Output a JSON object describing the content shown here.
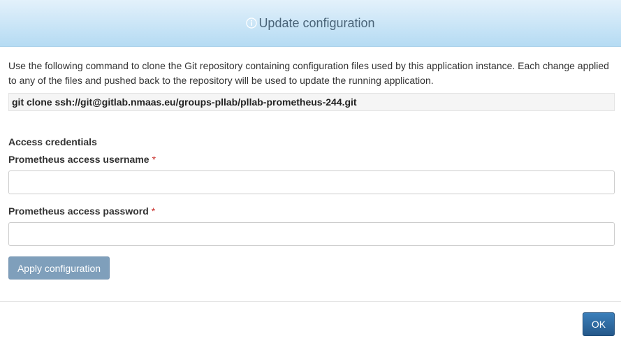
{
  "header": {
    "title": "Update configuration",
    "icon": "info-icon"
  },
  "intro": {
    "text": "Use the following command to clone the Git repository containing configuration files used by this application instance. Each change applied to any of the files and pushed back to the repository will be used to update the running application."
  },
  "command": {
    "text": "git clone ssh://git@gitlab.nmaas.eu/groups-pllab/pllab-prometheus-244.git"
  },
  "credentials": {
    "section_title": "Access credentials",
    "username_label": "Prometheus access username",
    "username_value": "",
    "password_label": "Prometheus access password",
    "password_value": "",
    "required_marker": "*"
  },
  "actions": {
    "apply_label": "Apply configuration",
    "ok_label": "OK"
  },
  "colors": {
    "header_gradient_top": "#e3f1fb",
    "header_gradient_bottom": "#b5dbf3",
    "apply_button": "#7f9fbb",
    "ok_button": "#2d6aa3",
    "required": "#c9302c"
  }
}
